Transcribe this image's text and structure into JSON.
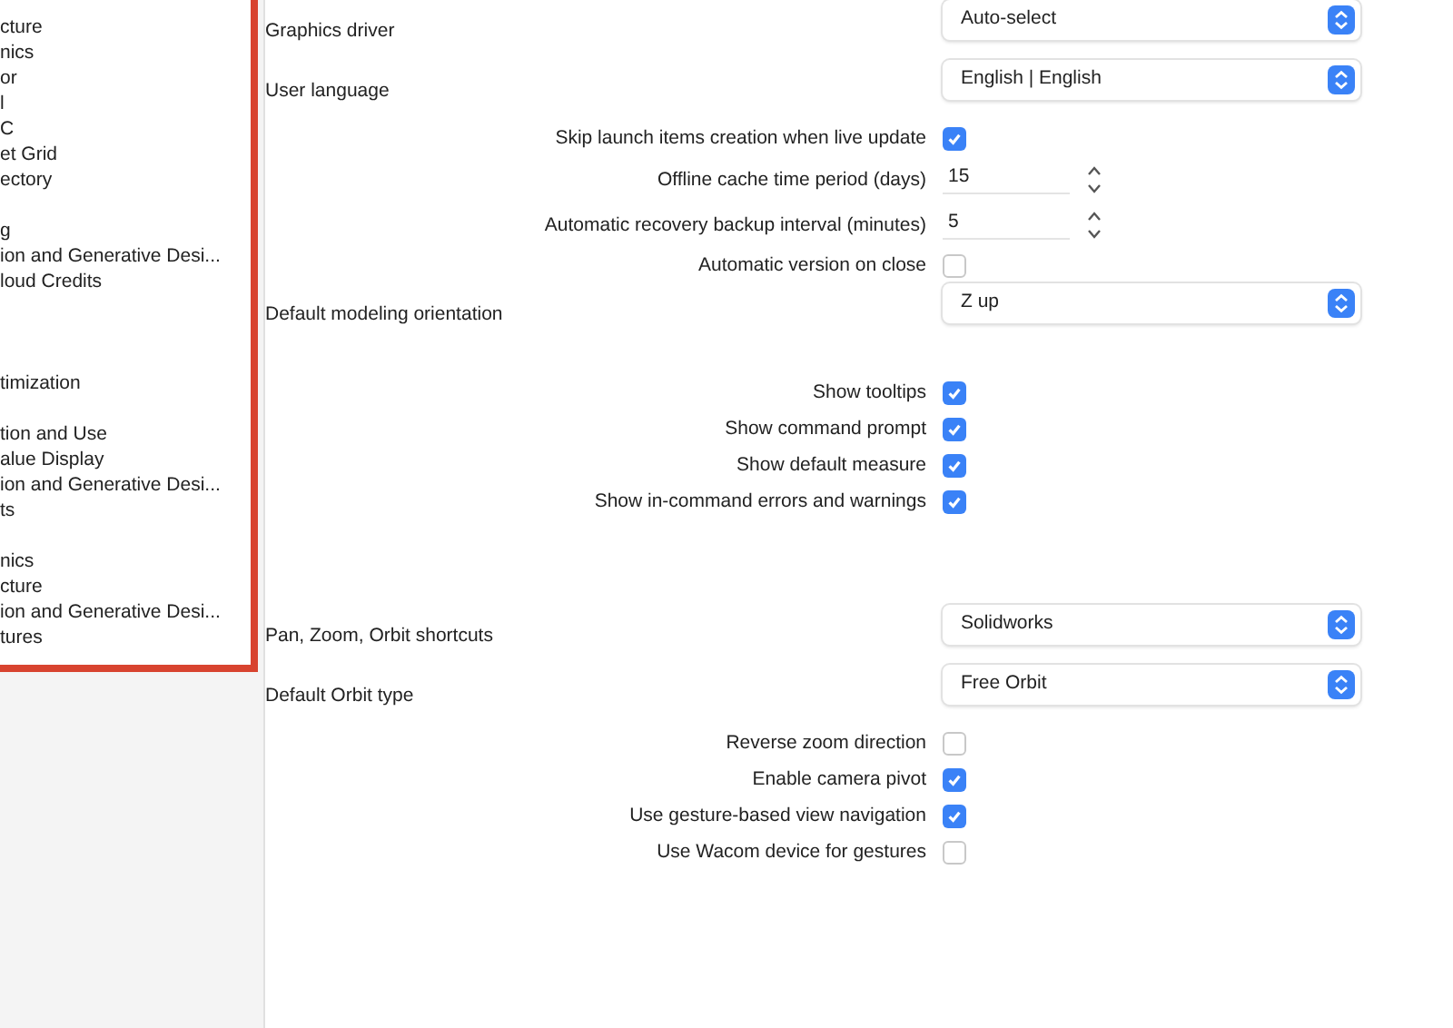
{
  "sidebar": {
    "groups": [
      [
        "cture",
        "nics",
        "or",
        "l",
        "C",
        "et Grid",
        "ectory"
      ],
      [
        "g",
        "ion and Generative Desi...",
        "loud Credits"
      ],
      [
        "timization"
      ],
      [
        "tion and Use",
        "alue Display",
        "ion and Generative Desi...",
        "ts"
      ],
      [
        "nics",
        "cture",
        "ion and Generative Desi...",
        "tures"
      ]
    ]
  },
  "sections": [
    {
      "rows": [
        {
          "kind": "select",
          "label": "Graphics driver",
          "value": "Auto-select"
        },
        {
          "kind": "select",
          "label": "User language",
          "value": "English | English"
        },
        {
          "kind": "checkbox",
          "label": "Skip launch items creation when live update",
          "checked": true
        },
        {
          "kind": "stepper",
          "label": "Offline cache time period (days)",
          "value": "15"
        },
        {
          "kind": "stepper",
          "label": "Automatic recovery backup interval (minutes)",
          "value": "5"
        },
        {
          "kind": "checkbox",
          "label": "Automatic version on close",
          "checked": false
        },
        {
          "kind": "select",
          "label": "Default modeling orientation",
          "value": "Z up"
        }
      ]
    },
    {
      "rows": [
        {
          "kind": "checkbox",
          "label": "Show tooltips",
          "checked": true
        },
        {
          "kind": "checkbox",
          "label": "Show command prompt",
          "checked": true
        },
        {
          "kind": "checkbox",
          "label": "Show default measure",
          "checked": true
        },
        {
          "kind": "checkbox",
          "label": "Show in-command errors and warnings",
          "checked": true
        }
      ]
    },
    {
      "rows": [
        {
          "kind": "select",
          "label": "Pan, Zoom, Orbit shortcuts",
          "value": "Solidworks"
        },
        {
          "kind": "select",
          "label": "Default Orbit type",
          "value": "Free Orbit"
        },
        {
          "kind": "checkbox",
          "label": "Reverse zoom direction",
          "checked": false
        },
        {
          "kind": "checkbox",
          "label": "Enable camera pivot",
          "checked": true
        },
        {
          "kind": "checkbox",
          "label": "Use gesture-based view navigation",
          "checked": true
        },
        {
          "kind": "checkbox",
          "label": "Use Wacom device for gestures",
          "checked": false
        }
      ]
    }
  ]
}
